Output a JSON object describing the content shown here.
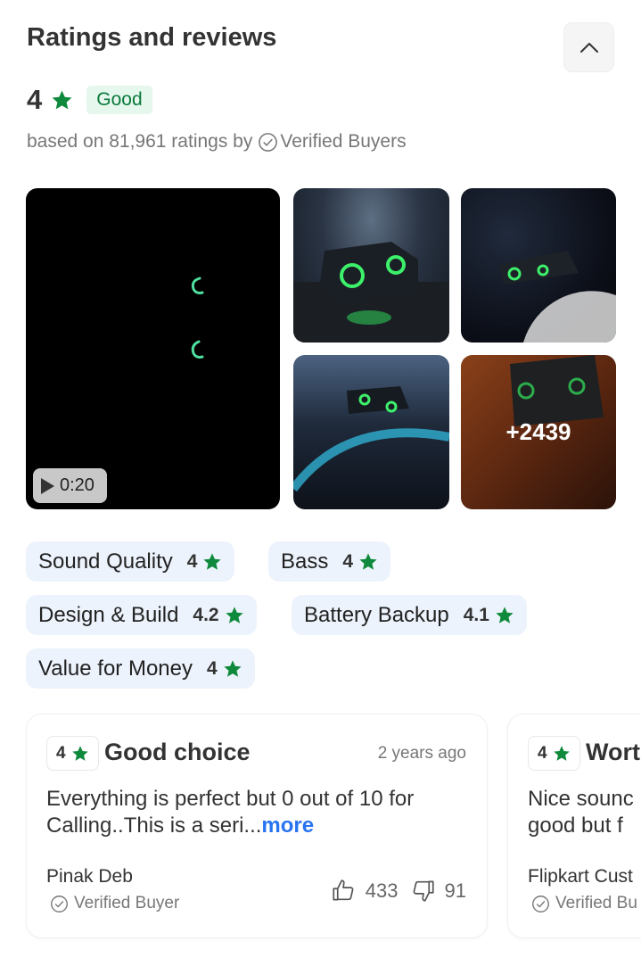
{
  "header": {
    "title": "Ratings and reviews"
  },
  "summary": {
    "rating": "4",
    "badge": "Good",
    "based_on_prefix": "based on 81,961 ratings by",
    "verified_label": "Verified Buyers"
  },
  "media": {
    "video_duration": "0:20",
    "more_count": "+2439"
  },
  "aspects": [
    {
      "label": "Sound Quality",
      "rating": "4"
    },
    {
      "label": "Bass",
      "rating": "4"
    },
    {
      "label": "Design & Build",
      "rating": "4.2"
    },
    {
      "label": "Battery Backup",
      "rating": "4.1"
    },
    {
      "label": "Value for Money",
      "rating": "4"
    }
  ],
  "reviews": [
    {
      "rating": "4",
      "title": "Good choice",
      "date": "2 years ago",
      "body": "Everything is perfect but 0 out of 10 for Calling..This is a seri...",
      "more": "more",
      "author": "Pinak Deb",
      "verified": "Verified Buyer",
      "likes": "433",
      "dislikes": "91"
    },
    {
      "rating": "4",
      "title": "Wort",
      "body": "Nice sounc good but f",
      "author": "Flipkart Cust",
      "verified": "Verified Bu"
    }
  ],
  "colors": {
    "star_green": "#0f8a3c",
    "badge_bg": "#e6f7ee",
    "chip_bg": "#edf3fc",
    "link_blue": "#2874f0"
  }
}
